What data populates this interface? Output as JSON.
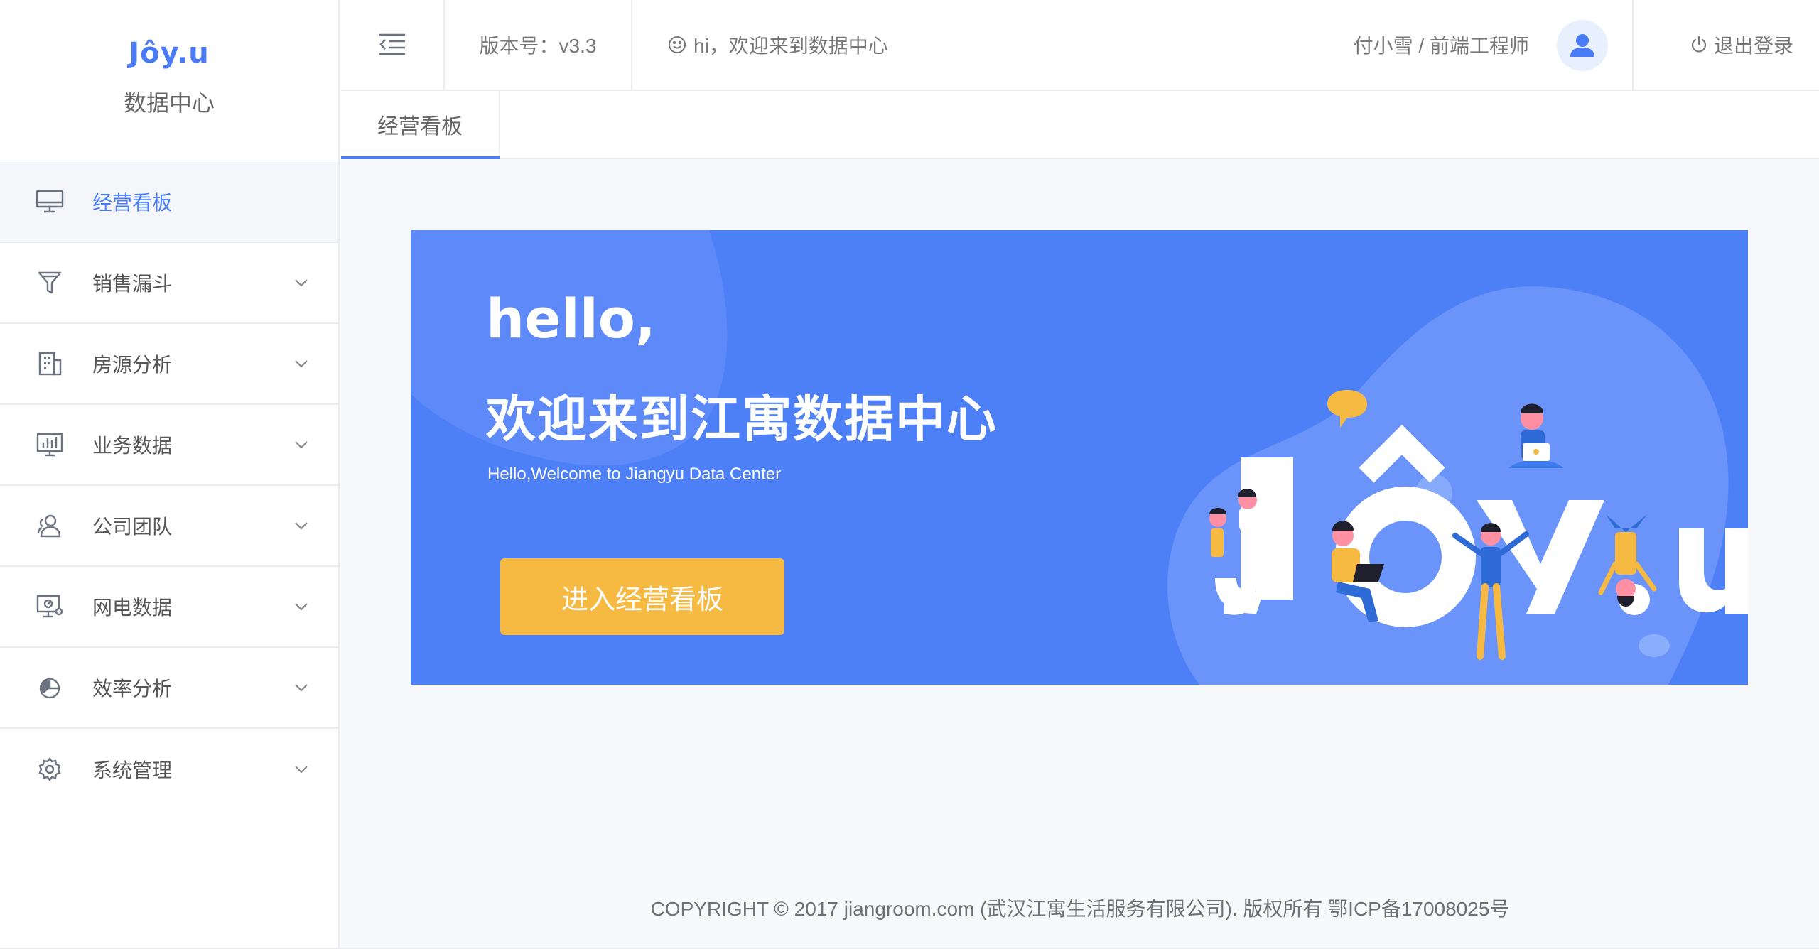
{
  "brand": {
    "logo_text": "Jôy.u",
    "title": "数据中心",
    "color": "#4a7cf8"
  },
  "sidebar": {
    "items": [
      {
        "label": "经营看板",
        "icon": "monitor-icon",
        "active": true
      },
      {
        "label": "销售漏斗",
        "icon": "funnel-icon"
      },
      {
        "label": "房源分析",
        "icon": "building-icon"
      },
      {
        "label": "业务数据",
        "icon": "bar-chart-icon"
      },
      {
        "label": "公司团队",
        "icon": "team-icon"
      },
      {
        "label": "网电数据",
        "icon": "screen-data-icon"
      },
      {
        "label": "效率分析",
        "icon": "pie-chart-icon"
      },
      {
        "label": "系统管理",
        "icon": "gear-icon"
      }
    ]
  },
  "header": {
    "toggle_icon": "menu-fold-icon",
    "version": "版本号：v3.3",
    "greeting": "hi，欢迎来到数据中心",
    "greeting_icon": "smile-icon",
    "user": "付小雪 / 前端工程师",
    "avatar_icon": "user-avatar-icon",
    "logout": "退出登录",
    "logout_icon": "power-icon"
  },
  "tabs": [
    {
      "label": "经营看板",
      "active": true
    }
  ],
  "banner": {
    "hello": "hello,",
    "welcome_cn": "欢迎来到江寓数据中心",
    "welcome_en": "Hello,Welcome to Jiangyu Data Center",
    "button": "进入经营看板",
    "bg_color": "#4d7ff7",
    "button_color": "#f6b942",
    "illustration_text": "Jôy.u"
  },
  "footer": {
    "copyright": "COPYRIGHT © 2017 jiangroom.com (武汉江寓生活服务有限公司). 版权所有 鄂ICP备17008025号"
  }
}
